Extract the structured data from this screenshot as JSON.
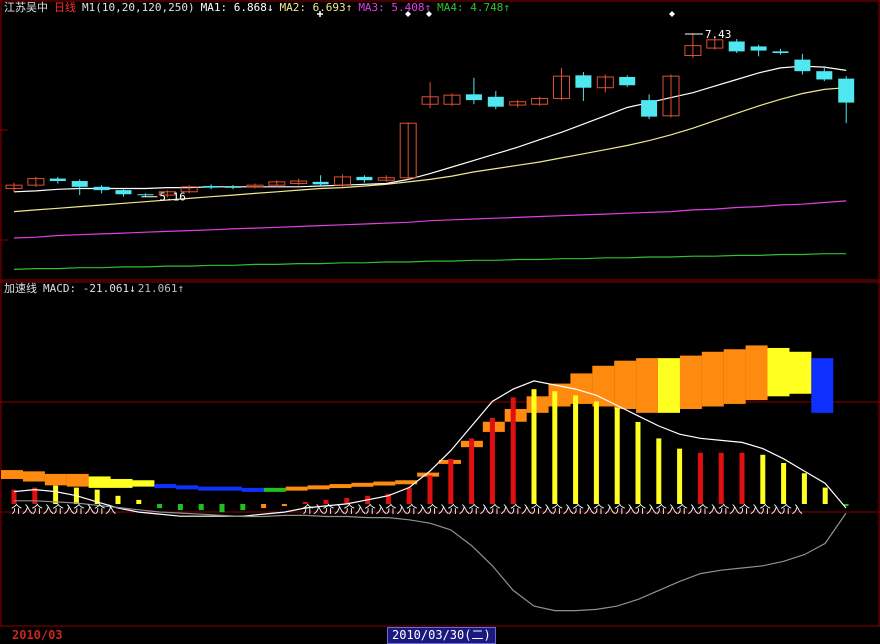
{
  "colors": {
    "bg": "#000000",
    "grid": "#8b0000",
    "up": "#e05030",
    "down": "#50e8f0",
    "ma1": "#ffffff",
    "ma2": "#f0e890",
    "ma3": "#e040e0",
    "ma4": "#30c030",
    "orange": "#ff8a10",
    "yellow": "#ffff20",
    "blue": "#1030ff",
    "green": "#20c020",
    "red": "#e01010",
    "curve_white": "#ffffff",
    "curve_gray": "#909090"
  },
  "top_panel": {
    "stock_name": "江苏吴中",
    "period": "日线",
    "m1_label": "M1(10,20,120,250)",
    "ma1": "MA1: 6.868↓",
    "ma2": "MA2: 6.693↑",
    "ma3": "MA3: 5.408↑",
    "ma4": "MA4: 4.748↑",
    "high_label": "7.43",
    "low_label": "5.16"
  },
  "bottom_panel": {
    "indicator": "加速线",
    "macd": "MACD: -21.061↓",
    "macd2": "21.061↑",
    "signal_text": "介入"
  },
  "date_bar": {
    "left_date": "2010/03",
    "cursor_date": "2010/03/30(二)"
  },
  "chart_data": {
    "type": "candlestick",
    "price_axis_range": [
      4.5,
      7.6
    ],
    "candles": [
      {
        "o": 5.56,
        "c": 5.6,
        "h": 5.63,
        "l": 5.52
      },
      {
        "o": 5.6,
        "c": 5.68,
        "h": 5.7,
        "l": 5.58
      },
      {
        "o": 5.68,
        "c": 5.65,
        "h": 5.7,
        "l": 5.62
      },
      {
        "o": 5.65,
        "c": 5.58,
        "h": 5.67,
        "l": 5.48
      },
      {
        "o": 5.58,
        "c": 5.54,
        "h": 5.6,
        "l": 5.5
      },
      {
        "o": 5.54,
        "c": 5.49,
        "h": 5.55,
        "l": 5.46
      },
      {
        "o": 5.49,
        "c": 5.48,
        "h": 5.5,
        "l": 5.46
      },
      {
        "o": 5.48,
        "c": 5.52,
        "h": 5.54,
        "l": 5.45
      },
      {
        "o": 5.52,
        "c": 5.58,
        "h": 5.6,
        "l": 5.5
      },
      {
        "o": 5.59,
        "c": 5.57,
        "h": 5.61,
        "l": 5.55
      },
      {
        "o": 5.58,
        "c": 5.57,
        "h": 5.6,
        "l": 5.55
      },
      {
        "o": 5.58,
        "c": 5.6,
        "h": 5.62,
        "l": 5.56
      },
      {
        "o": 5.6,
        "c": 5.64,
        "h": 5.66,
        "l": 5.58
      },
      {
        "o": 5.62,
        "c": 5.65,
        "h": 5.68,
        "l": 5.6
      },
      {
        "o": 5.64,
        "c": 5.61,
        "h": 5.72,
        "l": 5.59
      },
      {
        "o": 5.6,
        "c": 5.7,
        "h": 5.73,
        "l": 5.58
      },
      {
        "o": 5.7,
        "c": 5.66,
        "h": 5.72,
        "l": 5.63
      },
      {
        "o": 5.66,
        "c": 5.69,
        "h": 5.72,
        "l": 5.64
      },
      {
        "o": 5.69,
        "c": 6.35,
        "h": 6.36,
        "l": 5.67
      },
      {
        "o": 6.58,
        "c": 6.67,
        "h": 6.85,
        "l": 6.53
      },
      {
        "o": 6.58,
        "c": 6.69,
        "h": 6.71,
        "l": 6.56
      },
      {
        "o": 6.7,
        "c": 6.63,
        "h": 6.9,
        "l": 6.58
      },
      {
        "o": 6.67,
        "c": 6.55,
        "h": 6.74,
        "l": 6.52
      },
      {
        "o": 6.57,
        "c": 6.61,
        "h": 6.63,
        "l": 6.54
      },
      {
        "o": 6.58,
        "c": 6.65,
        "h": 6.67,
        "l": 6.56
      },
      {
        "o": 6.65,
        "c": 6.92,
        "h": 7.02,
        "l": 6.63
      },
      {
        "o": 6.93,
        "c": 6.78,
        "h": 6.97,
        "l": 6.62
      },
      {
        "o": 6.78,
        "c": 6.91,
        "h": 6.94,
        "l": 6.72
      },
      {
        "o": 6.91,
        "c": 6.81,
        "h": 6.93,
        "l": 6.79
      },
      {
        "o": 6.63,
        "c": 6.43,
        "h": 6.7,
        "l": 6.4
      },
      {
        "o": 6.44,
        "c": 6.92,
        "h": 6.94,
        "l": 6.42
      },
      {
        "o": 7.17,
        "c": 7.29,
        "h": 7.43,
        "l": 7.14
      },
      {
        "o": 7.26,
        "c": 7.36,
        "h": 7.4,
        "l": 7.24
      },
      {
        "o": 7.34,
        "c": 7.22,
        "h": 7.37,
        "l": 7.2
      },
      {
        "o": 7.28,
        "c": 7.23,
        "h": 7.3,
        "l": 7.16
      },
      {
        "o": 7.22,
        "c": 7.2,
        "h": 7.25,
        "l": 7.18
      },
      {
        "o": 7.12,
        "c": 6.98,
        "h": 7.19,
        "l": 6.94
      },
      {
        "o": 6.98,
        "c": 6.88,
        "h": 7.04,
        "l": 6.86
      },
      {
        "o": 6.89,
        "c": 6.6,
        "h": 6.92,
        "l": 6.35
      }
    ],
    "ma1": [
      5.52,
      5.53,
      5.55,
      5.56,
      5.56,
      5.56,
      5.56,
      5.57,
      5.57,
      5.58,
      5.58,
      5.58,
      5.58,
      5.58,
      5.59,
      5.6,
      5.61,
      5.62,
      5.67,
      5.74,
      5.82,
      5.9,
      5.98,
      6.06,
      6.15,
      6.24,
      6.34,
      6.44,
      6.54,
      6.6,
      6.66,
      6.72,
      6.8,
      6.88,
      6.96,
      7.02,
      7.04,
      7.03,
      6.99
    ],
    "ma2": [
      5.28,
      5.3,
      5.32,
      5.34,
      5.36,
      5.38,
      5.4,
      5.42,
      5.44,
      5.46,
      5.48,
      5.5,
      5.52,
      5.54,
      5.56,
      5.57,
      5.59,
      5.61,
      5.64,
      5.67,
      5.71,
      5.76,
      5.8,
      5.84,
      5.88,
      5.93,
      5.98,
      6.03,
      6.08,
      6.14,
      6.21,
      6.29,
      6.38,
      6.47,
      6.56,
      6.64,
      6.71,
      6.76,
      6.78
    ],
    "ma3": [
      4.96,
      4.97,
      4.99,
      5.0,
      5.01,
      5.02,
      5.03,
      5.04,
      5.05,
      5.06,
      5.07,
      5.08,
      5.09,
      5.1,
      5.11,
      5.12,
      5.13,
      5.14,
      5.15,
      5.17,
      5.18,
      5.19,
      5.2,
      5.21,
      5.22,
      5.23,
      5.24,
      5.25,
      5.26,
      5.27,
      5.28,
      5.3,
      5.31,
      5.33,
      5.34,
      5.36,
      5.37,
      5.39,
      5.41
    ],
    "ma4": [
      4.58,
      4.59,
      4.59,
      4.6,
      4.6,
      4.61,
      4.61,
      4.62,
      4.62,
      4.63,
      4.63,
      4.64,
      4.64,
      4.65,
      4.65,
      4.66,
      4.66,
      4.67,
      4.67,
      4.68,
      4.68,
      4.69,
      4.69,
      4.7,
      4.7,
      4.71,
      4.71,
      4.72,
      4.72,
      4.73,
      4.73,
      4.74,
      4.74,
      4.75,
      4.75,
      4.76,
      4.76,
      4.77,
      4.77
    ],
    "accel_range": [
      -100,
      150
    ],
    "accel_bars": [
      {
        "v": 0,
        "t": -10,
        "c": "orange"
      },
      {
        "v": 0,
        "t": -9,
        "c": "orange"
      },
      {
        "v": 0,
        "t": -7,
        "c": "orange"
      },
      {
        "v": 0,
        "t": -7,
        "c": "orange"
      },
      {
        "v": 0,
        "t": -5,
        "c": "yellow"
      },
      {
        "v": 0,
        "t": -3,
        "c": "yellow"
      },
      {
        "v": 0,
        "t": -2,
        "c": "yellow"
      },
      {
        "v": 0,
        "t": 1,
        "c": "blue"
      },
      {
        "v": 0,
        "t": 2,
        "c": "blue"
      },
      {
        "v": 0,
        "t": 3,
        "c": "blue"
      },
      {
        "v": 0,
        "t": 3,
        "c": "blue"
      },
      {
        "v": 0,
        "t": 4,
        "c": "blue"
      },
      {
        "v": 0,
        "t": 4,
        "c": "green"
      },
      {
        "v": 0,
        "t": 3,
        "c": "orange"
      },
      {
        "v": 0,
        "t": 2,
        "c": "orange"
      },
      {
        "v": 0,
        "t": 1,
        "c": "orange"
      },
      {
        "v": 0,
        "t": 0,
        "c": "orange"
      },
      {
        "v": 0,
        "t": -1,
        "c": "orange"
      },
      {
        "v": 0,
        "t": -2,
        "c": "orange"
      },
      {
        "v": 0,
        "t": -8,
        "c": "orange"
      },
      {
        "v": 0,
        "t": -18,
        "c": "orange"
      },
      {
        "v": 0,
        "t": -33,
        "c": "orange"
      },
      {
        "v": 0,
        "t": -48,
        "c": "orange"
      },
      {
        "v": 0,
        "t": -58,
        "c": "orange"
      },
      {
        "v": 0,
        "t": -68,
        "c": "orange"
      },
      {
        "v": 0,
        "t": -78,
        "c": "orange"
      },
      {
        "v": 0,
        "t": -86,
        "c": "orange"
      },
      {
        "v": 0,
        "t": -92,
        "c": "orange"
      },
      {
        "v": 0,
        "t": -96,
        "c": "orange"
      },
      {
        "v": 0,
        "t": -98,
        "c": "orange"
      },
      {
        "v": 0,
        "t": -98,
        "c": "yellow"
      },
      {
        "v": 0,
        "t": -100,
        "c": "orange"
      },
      {
        "v": 0,
        "t": -103,
        "c": "orange"
      },
      {
        "v": 0,
        "t": -105,
        "c": "orange"
      },
      {
        "v": 0,
        "t": -108,
        "c": "orange"
      },
      {
        "v": 0,
        "t": -106,
        "c": "yellow"
      },
      {
        "v": 0,
        "t": -103,
        "c": "yellow"
      },
      {
        "v": 0,
        "t": -98,
        "c": "blue"
      }
    ],
    "accel_bar_bottoms": [
      -3,
      -1,
      2,
      3,
      4,
      4,
      3,
      4,
      4,
      5,
      5,
      5,
      5,
      5,
      5,
      4,
      3,
      2,
      0,
      -5,
      -15,
      -28,
      -40,
      -48,
      -55,
      -60,
      -62,
      -60,
      -58,
      -55,
      -55,
      -58,
      -60,
      -62,
      -65,
      -68,
      -70,
      -55
    ],
    "macd_bars": [
      {
        "v": -7,
        "c": "red"
      },
      {
        "v": -8,
        "c": "red"
      },
      {
        "v": -9,
        "c": "yellow"
      },
      {
        "v": -8,
        "c": "yellow"
      },
      {
        "v": -7,
        "c": "yellow"
      },
      {
        "v": -4,
        "c": "yellow"
      },
      {
        "v": -2,
        "c": "yellow"
      },
      {
        "v": 2,
        "c": "green"
      },
      {
        "v": 3,
        "c": "green"
      },
      {
        "v": 3,
        "c": "green"
      },
      {
        "v": 4,
        "c": "green"
      },
      {
        "v": 3,
        "c": "green"
      },
      {
        "v": 2,
        "c": "orange"
      },
      {
        "v": 1,
        "c": "orange"
      },
      {
        "v": -1,
        "c": "red"
      },
      {
        "v": -2,
        "c": "red"
      },
      {
        "v": -3,
        "c": "red"
      },
      {
        "v": -4,
        "c": "red"
      },
      {
        "v": -5,
        "c": "red"
      },
      {
        "v": -8,
        "c": "red"
      },
      {
        "v": -14,
        "c": "red"
      },
      {
        "v": -22,
        "c": "red"
      },
      {
        "v": -32,
        "c": "red"
      },
      {
        "v": -42,
        "c": "red"
      },
      {
        "v": -52,
        "c": "red"
      },
      {
        "v": -56,
        "c": "yellow"
      },
      {
        "v": -55,
        "c": "yellow"
      },
      {
        "v": -53,
        "c": "yellow"
      },
      {
        "v": -50,
        "c": "yellow"
      },
      {
        "v": -47,
        "c": "yellow"
      },
      {
        "v": -40,
        "c": "yellow"
      },
      {
        "v": -32,
        "c": "yellow"
      },
      {
        "v": -27,
        "c": "yellow"
      },
      {
        "v": -25,
        "c": "red"
      },
      {
        "v": -25,
        "c": "red"
      },
      {
        "v": -25,
        "c": "red"
      },
      {
        "v": -24,
        "c": "yellow"
      },
      {
        "v": -20,
        "c": "yellow"
      },
      {
        "v": -15,
        "c": "yellow"
      },
      {
        "v": -8,
        "c": "yellow"
      },
      {
        "v": 1,
        "c": "green"
      }
    ],
    "white_curve": [
      -8,
      -9,
      -8,
      -6,
      -3,
      0,
      2,
      3,
      4,
      4,
      4,
      4,
      3,
      2,
      0,
      -1,
      -2,
      -4,
      -6,
      -10,
      -18,
      -28,
      -40,
      -52,
      -58,
      -62,
      -60,
      -58,
      -55,
      -50,
      -45,
      -40,
      -36,
      -34,
      -33,
      -32,
      -29,
      -24,
      -18,
      -12,
      0
    ],
    "gray_curve": [
      10,
      10,
      9,
      8,
      6,
      4,
      2,
      0,
      -1,
      -2,
      -3,
      -4,
      -4,
      -3,
      -3,
      -4,
      -4,
      -5,
      -5,
      -7,
      -10,
      -16,
      -30,
      -48,
      -70,
      -84,
      -88,
      -88,
      -87,
      -84,
      -78,
      -70,
      -62,
      -55,
      -52,
      -50,
      -48,
      -44,
      -38,
      -28,
      -1
    ],
    "signal_groups": [
      [
        0,
        4
      ],
      [
        14,
        30
      ],
      [
        31,
        37
      ]
    ]
  }
}
